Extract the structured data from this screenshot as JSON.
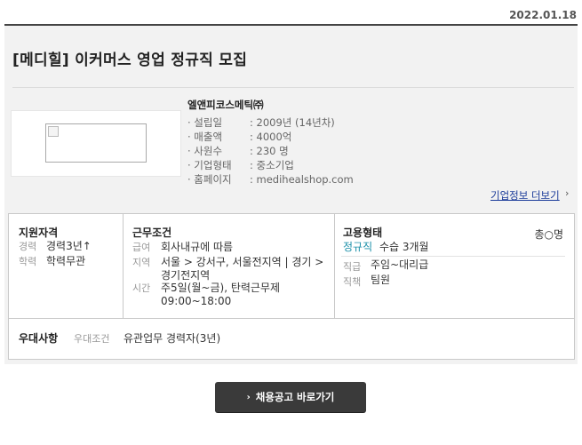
{
  "header": {
    "date": "2022.01.18"
  },
  "job": {
    "title": "[메디힐] 이커머스 영업 정규직 모집"
  },
  "company": {
    "name": "엘앤피코스메틱㈜",
    "info": [
      {
        "label": "· 설립일",
        "value": ": 2009년 (14년차)"
      },
      {
        "label": "· 매출액",
        "value": ": 4000억"
      },
      {
        "label": "· 사원수",
        "value": ": 230 명"
      },
      {
        "label": "· 기업형태",
        "value": ": 중소기업"
      },
      {
        "label": "· 홈페이지",
        "value": ": medihealshop.com"
      }
    ],
    "more_link": "기업정보 더보기",
    "more_arrow": "›"
  },
  "qualification": {
    "title": "지원자격",
    "rows": [
      {
        "key": "경력",
        "value": "경력3년↑"
      },
      {
        "key": "학력",
        "value": "학력무관"
      }
    ]
  },
  "conditions": {
    "title": "근무조건",
    "rows": [
      {
        "key": "급여",
        "value": "회사내규에 따름"
      },
      {
        "key": "지역",
        "value": "서울 > 강서구, 서울전지역 | 경기 > 경기전지역"
      },
      {
        "key": "시간",
        "value": "주5일(월~금), 탄력근무제09:00~18:00"
      }
    ]
  },
  "employment": {
    "title": "고용형태",
    "headcount": "총○명",
    "type": "정규직",
    "type_note": "수습 3개월",
    "type_color": "#1a8fa8",
    "rows": [
      {
        "key": "직급",
        "value": "주임~대리급"
      },
      {
        "key": "직책",
        "value": "팀원"
      }
    ]
  },
  "preference": {
    "title": "우대사항",
    "key": "우대조건",
    "value": "유관업무 경력자(3년)"
  },
  "apply_button": {
    "arrow": "›",
    "label": "채용공고 바로가기"
  }
}
